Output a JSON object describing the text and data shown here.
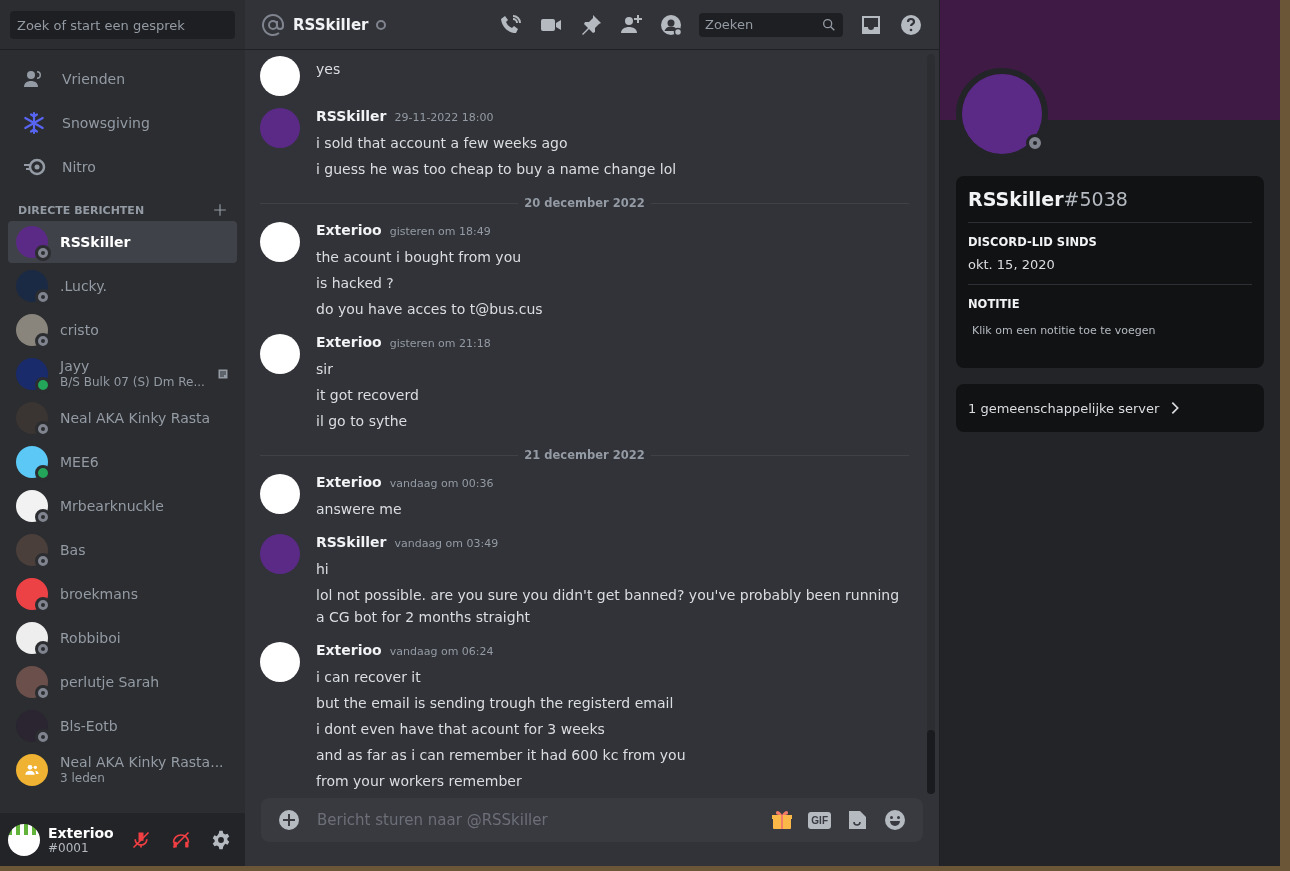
{
  "sidebar": {
    "search": {
      "placeholder": "Zoek of start een gesprek"
    },
    "nav": [
      {
        "label": "Vrienden",
        "kind": "friends"
      },
      {
        "label": "Snowsgiving",
        "kind": "snowflake"
      },
      {
        "label": "Nitro",
        "kind": "nitro"
      }
    ],
    "dm_heading": "DIRECTE BERICHTEN",
    "dms": [
      {
        "name": "RSSkiller",
        "online": false,
        "selected": true,
        "color": "#5b2a86"
      },
      {
        "name": ".Lucky.",
        "online": false,
        "selected": false,
        "color": "#1b2a44"
      },
      {
        "name": "cristo",
        "online": false,
        "selected": false,
        "color": "#8a857c"
      },
      {
        "name": "Jayy",
        "online": true,
        "selected": false,
        "color": "#1a2b6b",
        "activity": "B/S Bulk 07 (S) Dm Re..."
      },
      {
        "name": "Neal AKA Kinky Rasta",
        "online": false,
        "selected": false,
        "color": "#3a3532"
      },
      {
        "name": "MEE6",
        "online": true,
        "selected": false,
        "color": "#5bc8f5"
      },
      {
        "name": "Mrbearknuckle",
        "online": false,
        "selected": false,
        "color": "#f2f2f2"
      },
      {
        "name": "Bas",
        "online": false,
        "selected": false,
        "color": "#4a3f3a"
      },
      {
        "name": "broekmans",
        "online": false,
        "selected": false,
        "color": "#ed4245"
      },
      {
        "name": "Robbiboi",
        "online": false,
        "selected": false,
        "color": "#eeeeee"
      },
      {
        "name": "perlutje Sarah",
        "online": false,
        "selected": false,
        "color": "#6b4f4a"
      },
      {
        "name": "Bls-Eotb",
        "online": false,
        "selected": false,
        "color": "#2a2530"
      },
      {
        "name": "Neal AKA Kinky Rasta...",
        "kind": "group",
        "selected": false,
        "color": "#f0b232",
        "subtitle": "3 leden"
      }
    ],
    "user": {
      "name": "Exterioo",
      "tag": "#0001",
      "muted": true,
      "deafened": true
    }
  },
  "chat": {
    "title": "RSSkiller",
    "online": false,
    "search": {
      "placeholder": "Zoeken"
    },
    "messages": [
      {
        "kind": "continued",
        "color": "#ffffff",
        "lines": [
          "yes"
        ]
      },
      {
        "kind": "message",
        "color": "#5b2a86",
        "author": "RSSkiller",
        "time": "29-11-2022 18:00",
        "lines": [
          "i sold that account a few weeks ago",
          "i guess he was too cheap to buy a name change lol"
        ]
      },
      {
        "kind": "divider",
        "label": "20 december 2022"
      },
      {
        "kind": "message",
        "color": "#ffffff",
        "author": "Exterioo",
        "time": "gisteren om 18:49",
        "lines": [
          "the acount i bought from you",
          "is hacked ?",
          "do you have acces to t@bus.cus"
        ]
      },
      {
        "kind": "message",
        "color": "#ffffff",
        "author": "Exterioo",
        "time": "gisteren om 21:18",
        "lines": [
          "sir",
          "it got recoverd",
          "il go to sythe"
        ]
      },
      {
        "kind": "divider",
        "label": "21 december 2022"
      },
      {
        "kind": "message",
        "color": "#ffffff",
        "author": "Exterioo",
        "time": "vandaag om 00:36",
        "lines": [
          "answere me"
        ]
      },
      {
        "kind": "message",
        "color": "#5b2a86",
        "author": "RSSkiller",
        "time": "vandaag om 03:49",
        "lines": [
          "hi",
          "lol not possible. are you sure you didn't get banned? you've probably been running a CG bot for 2 months straight"
        ]
      },
      {
        "kind": "message",
        "color": "#ffffff",
        "author": "Exterioo",
        "time": "vandaag om 06:24",
        "lines": [
          "i can recover it",
          "but the email is sending trough the registerd email",
          "i dont even have that acount for 3 weeks",
          "and as far as i can remember it had 600 kc from you",
          "from your workers remember"
        ]
      }
    ],
    "composer": {
      "placeholder": "Bericht sturen naar @RSSkiller",
      "gif": "GIF"
    }
  },
  "profile": {
    "name": "RSSkiller",
    "discriminator": "#5038",
    "online": false,
    "sections": [
      {
        "title": "DISCORD-LID SINDS",
        "text": "okt. 15, 2020"
      },
      {
        "title": "NOTITIE",
        "placeholder": "Klik om een notitie toe te voegen"
      }
    ],
    "mutual": "1 gemeenschappelijke server"
  }
}
